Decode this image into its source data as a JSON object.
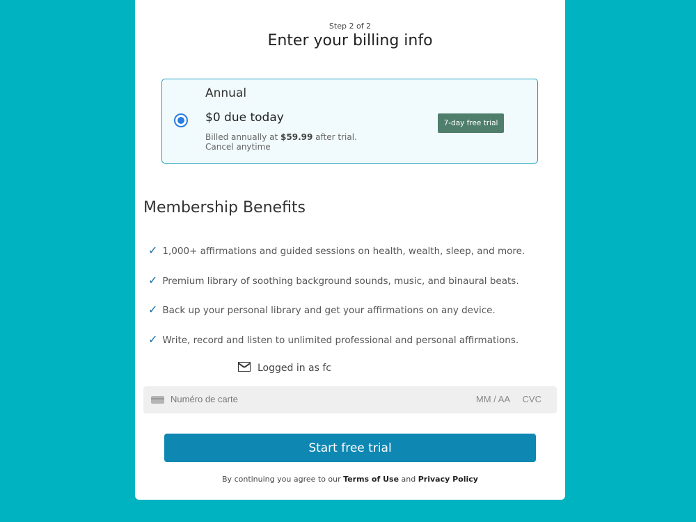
{
  "header": {
    "step": "Step 2 of 2",
    "title": "Enter your billing info"
  },
  "plan": {
    "name": "Annual",
    "due": "$0 due today",
    "note_prefix": "Billed annually at ",
    "price": "$59.99",
    "note_suffix": " after trial.",
    "note_line2": "Cancel anytime",
    "badge": "7-day free trial",
    "selected": true
  },
  "benefits": {
    "title": "Membership Benefits",
    "items": [
      "1,000+ affirmations and guided sessions on health, wealth, sleep, and more.",
      "Premium library of soothing background sounds, music, and binaural beats.",
      "Back up your personal library and get your affirmations on any device.",
      "Write, record and listen to unlimited professional and personal affirmations."
    ]
  },
  "account": {
    "logged_in_label": "Logged in as fc"
  },
  "payment": {
    "card_placeholder": "Numéro de carte",
    "expiry_placeholder": "MM / AA",
    "cvc_placeholder": "CVC"
  },
  "cta": {
    "label": "Start free trial"
  },
  "legal": {
    "prefix": "By continuing you agree to our ",
    "terms": "Terms of Use",
    "and": " and ",
    "privacy": "Privacy Policy"
  },
  "colors": {
    "background": "#00b3c0",
    "primary_button": "#0e87b3",
    "badge": "#4f7f6c",
    "check": "#1a6fa6"
  }
}
